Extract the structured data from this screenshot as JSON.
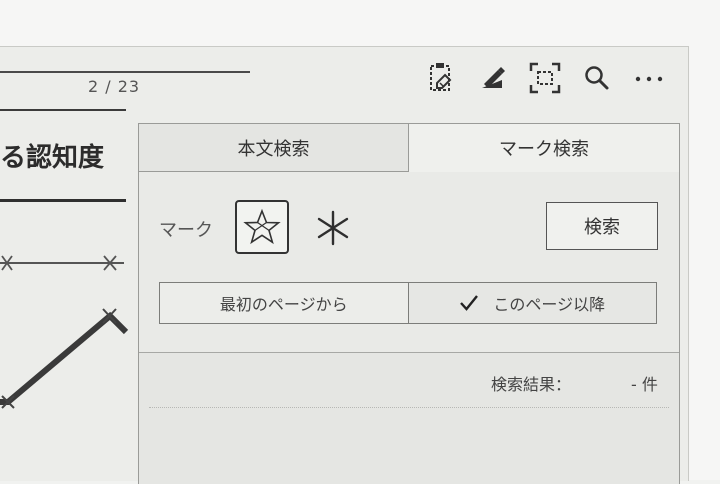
{
  "header": {
    "page_counter": "2 / 23"
  },
  "toolbar": {
    "icons": [
      "clipboard-edit-icon",
      "pen-icon",
      "screen-capture-icon",
      "search-icon",
      "more-icon"
    ]
  },
  "document": {
    "heading_fragment": "る認知度"
  },
  "search_panel": {
    "tabs": [
      {
        "label": "本文検索",
        "active": false
      },
      {
        "label": "マーク検索",
        "active": true
      }
    ],
    "mark_label": "マーク",
    "marks": [
      "star-mark",
      "asterisk-mark"
    ],
    "search_button": "検索",
    "range_options": [
      {
        "label": "最初のページから",
        "selected": false
      },
      {
        "label": "このページ以降",
        "selected": true
      }
    ],
    "result_label": "検索結果：",
    "result_count": "- 件"
  },
  "colors": {
    "screen_bg": "#ecedea",
    "ink": "#2f2f2f",
    "border": "#9a9b98"
  }
}
